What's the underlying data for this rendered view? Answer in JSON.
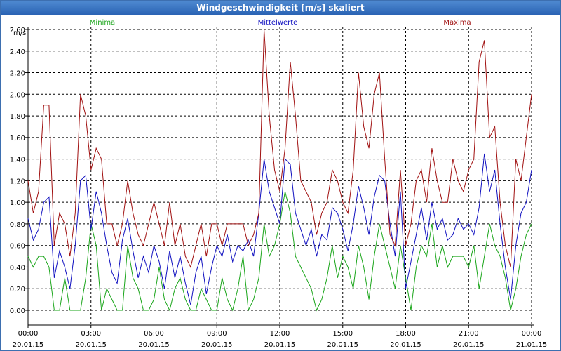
{
  "window": {
    "title": "Windgeschwindigkeit [m/s] skaliert"
  },
  "colors": {
    "minima": "#1aa51a",
    "mittelwerte": "#1010c0",
    "maxima": "#a01010",
    "axis": "#000000",
    "grid": "#000000"
  },
  "chart_data": {
    "type": "line",
    "title": "Windgeschwindigkeit [m/s] skaliert",
    "ylabel": "m/s",
    "ylim": [
      0,
      2.6
    ],
    "y_ticks": [
      "0,00",
      "0,20",
      "0,40",
      "0,60",
      "0,80",
      "1,00",
      "1,20",
      "1,40",
      "1,60",
      "1,80",
      "2,00",
      "2,20",
      "2,40",
      "2,60"
    ],
    "xlim_hours": [
      0,
      24
    ],
    "x_tick_labels": [
      {
        "time": "00:00",
        "date": "20.01.15"
      },
      {
        "time": "03:00",
        "date": "20.01.15"
      },
      {
        "time": "06:00",
        "date": "20.01.15"
      },
      {
        "time": "09:00",
        "date": "20.01.15"
      },
      {
        "time": "12:00",
        "date": "20.01.15"
      },
      {
        "time": "15:00",
        "date": "20.01.15"
      },
      {
        "time": "18:00",
        "date": "20.01.15"
      },
      {
        "time": "21:00",
        "date": "20.01.15"
      },
      {
        "time": "00:00",
        "date": "21.01.15"
      }
    ],
    "grid": true,
    "legend": "top",
    "series": [
      {
        "name": "Minima",
        "color": "#1aa51a",
        "x": [
          0,
          0.25,
          0.5,
          0.75,
          1,
          1.25,
          1.5,
          1.75,
          2,
          2.25,
          2.5,
          2.75,
          3,
          3.25,
          3.5,
          3.75,
          4,
          4.25,
          4.5,
          4.75,
          5,
          5.25,
          5.5,
          5.75,
          6,
          6.25,
          6.5,
          6.75,
          7,
          7.25,
          7.5,
          7.75,
          8,
          8.25,
          8.5,
          8.75,
          9,
          9.25,
          9.5,
          9.75,
          10,
          10.25,
          10.5,
          10.75,
          11,
          11.25,
          11.5,
          11.75,
          12,
          12.25,
          12.5,
          12.75,
          13,
          13.25,
          13.5,
          13.75,
          14,
          14.25,
          14.5,
          14.75,
          15,
          15.25,
          15.5,
          15.75,
          16,
          16.25,
          16.5,
          16.75,
          17,
          17.25,
          17.5,
          17.75,
          18,
          18.25,
          18.5,
          18.75,
          19,
          19.25,
          19.5,
          19.75,
          20,
          20.25,
          20.5,
          20.75,
          21,
          21.25,
          21.5,
          21.75,
          22,
          22.25,
          22.5,
          22.75,
          23,
          23.25,
          23.5,
          23.75,
          24
        ],
        "y": [
          0.5,
          0.4,
          0.5,
          0.5,
          0.4,
          0,
          0,
          0.3,
          0,
          0,
          0,
          0.3,
          0.8,
          0.6,
          0,
          0.2,
          0.1,
          0,
          0,
          0.6,
          0.3,
          0.2,
          0,
          0,
          0.1,
          0.4,
          0.1,
          0,
          0.2,
          0.3,
          0.1,
          0,
          0,
          0.2,
          0.1,
          0,
          0,
          0.3,
          0.1,
          0,
          0.2,
          0.5,
          0,
          0.1,
          0.3,
          0.8,
          0.5,
          0.6,
          0.8,
          1.1,
          0.9,
          0.5,
          0.4,
          0.3,
          0.2,
          0,
          0.1,
          0.3,
          0.6,
          0.3,
          0.5,
          0.4,
          0.2,
          0.6,
          0.4,
          0.1,
          0.5,
          0.8,
          0.6,
          0.4,
          0.2,
          0.6,
          0.3,
          0,
          0.4,
          0.6,
          0.5,
          0.8,
          0.4,
          0.6,
          0.4,
          0.5,
          0.5,
          0.5,
          0.4,
          0.6,
          0.2,
          0.5,
          0.8,
          0.6,
          0.5,
          0.3,
          0,
          0.2,
          0.5,
          0.7,
          0.8
        ]
      },
      {
        "name": "Mittelwerte",
        "color": "#1010c0",
        "x": [
          0,
          0.25,
          0.5,
          0.75,
          1,
          1.25,
          1.5,
          1.75,
          2,
          2.25,
          2.5,
          2.75,
          3,
          3.25,
          3.5,
          3.75,
          4,
          4.25,
          4.5,
          4.75,
          5,
          5.25,
          5.5,
          5.75,
          6,
          6.25,
          6.5,
          6.75,
          7,
          7.25,
          7.5,
          7.75,
          8,
          8.25,
          8.5,
          8.75,
          9,
          9.25,
          9.5,
          9.75,
          10,
          10.25,
          10.5,
          10.75,
          11,
          11.25,
          11.5,
          11.75,
          12,
          12.25,
          12.5,
          12.75,
          13,
          13.25,
          13.5,
          13.75,
          14,
          14.25,
          14.5,
          14.75,
          15,
          15.25,
          15.5,
          15.75,
          16,
          16.25,
          16.5,
          16.75,
          17,
          17.25,
          17.5,
          17.75,
          18,
          18.25,
          18.5,
          18.75,
          19,
          19.25,
          19.5,
          19.75,
          20,
          20.25,
          20.5,
          20.75,
          21,
          21.25,
          21.5,
          21.75,
          22,
          22.25,
          22.5,
          22.75,
          23,
          23.25,
          23.5,
          23.75,
          24
        ],
        "y": [
          0.85,
          0.65,
          0.75,
          1.0,
          1.05,
          0.3,
          0.55,
          0.4,
          0.2,
          0.6,
          1.2,
          1.25,
          0.75,
          1.1,
          0.9,
          0.6,
          0.35,
          0.25,
          0.65,
          0.85,
          0.55,
          0.3,
          0.5,
          0.35,
          0.6,
          0.45,
          0.2,
          0.55,
          0.3,
          0.5,
          0.25,
          0.05,
          0.35,
          0.5,
          0.15,
          0.4,
          0.6,
          0.5,
          0.7,
          0.45,
          0.6,
          0.55,
          0.65,
          0.5,
          0.9,
          1.4,
          1.1,
          0.95,
          0.8,
          1.4,
          1.35,
          0.9,
          0.75,
          0.6,
          0.75,
          0.5,
          0.7,
          0.65,
          0.95,
          0.9,
          0.75,
          0.55,
          0.8,
          1.15,
          0.95,
          0.7,
          1.05,
          1.25,
          1.2,
          0.8,
          0.5,
          1.1,
          0.2,
          0.45,
          0.7,
          0.95,
          0.65,
          1.0,
          0.75,
          0.85,
          0.65,
          0.7,
          0.85,
          0.75,
          0.8,
          0.7,
          0.95,
          1.45,
          1.1,
          1.3,
          0.8,
          0.4,
          0.1,
          0.6,
          0.9,
          1.0,
          1.3
        ]
      },
      {
        "name": "Maxima",
        "color": "#a01010",
        "x": [
          0,
          0.25,
          0.5,
          0.75,
          1,
          1.25,
          1.5,
          1.75,
          2,
          2.25,
          2.5,
          2.75,
          3,
          3.25,
          3.5,
          3.75,
          4,
          4.25,
          4.5,
          4.75,
          5,
          5.25,
          5.5,
          5.75,
          6,
          6.25,
          6.5,
          6.75,
          7,
          7.25,
          7.5,
          7.75,
          8,
          8.25,
          8.5,
          8.75,
          9,
          9.25,
          9.5,
          9.75,
          10,
          10.25,
          10.5,
          10.75,
          11,
          11.25,
          11.5,
          11.75,
          12,
          12.25,
          12.5,
          12.75,
          13,
          13.25,
          13.5,
          13.75,
          14,
          14.25,
          14.5,
          14.75,
          15,
          15.25,
          15.5,
          15.75,
          16,
          16.25,
          16.5,
          16.75,
          17,
          17.25,
          17.5,
          17.75,
          18,
          18.25,
          18.5,
          18.75,
          19,
          19.25,
          19.5,
          19.75,
          20,
          20.25,
          20.5,
          20.75,
          21,
          21.25,
          21.5,
          21.75,
          22,
          22.25,
          22.5,
          22.75,
          23,
          23.25,
          23.5,
          23.75,
          24
        ],
        "y": [
          1.2,
          0.9,
          1.1,
          1.9,
          1.9,
          0.6,
          0.9,
          0.8,
          0.5,
          0.9,
          2.0,
          1.8,
          1.3,
          1.5,
          1.4,
          0.8,
          0.8,
          0.6,
          0.8,
          1.2,
          0.9,
          0.7,
          0.6,
          0.8,
          1.0,
          0.8,
          0.6,
          1.0,
          0.6,
          0.8,
          0.5,
          0.4,
          0.6,
          0.8,
          0.5,
          0.8,
          0.8,
          0.6,
          0.8,
          0.8,
          0.8,
          0.8,
          0.6,
          0.7,
          0.9,
          2.6,
          1.8,
          1.3,
          1.1,
          1.5,
          2.3,
          1.8,
          1.2,
          1.1,
          1.0,
          0.7,
          0.9,
          1.0,
          1.3,
          1.2,
          1.0,
          0.9,
          1.3,
          2.2,
          1.7,
          1.5,
          2.0,
          2.2,
          1.4,
          0.7,
          0.6,
          1.3,
          0.6,
          0.8,
          1.2,
          1.3,
          1.0,
          1.5,
          1.2,
          1.0,
          1.0,
          1.4,
          1.2,
          1.1,
          1.3,
          1.4,
          2.3,
          2.5,
          1.6,
          1.7,
          1.0,
          0.6,
          0.4,
          1.4,
          1.2,
          1.6,
          2.0
        ]
      }
    ]
  }
}
